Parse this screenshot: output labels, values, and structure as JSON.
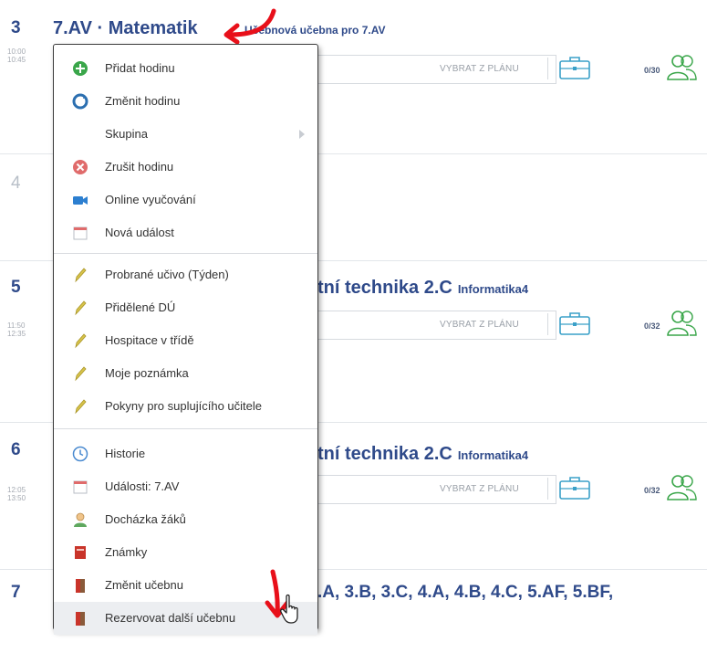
{
  "rows": [
    {
      "num": "3",
      "time_start": "10:00",
      "time_end": "10:45",
      "title": "7.AV · Matematik",
      "room": "Učebnová učebna pro 7.AV"
    },
    {
      "num": "4"
    },
    {
      "num": "5",
      "time_start": "11:50",
      "time_end": "12:35",
      "title": "tní technika  2.C",
      "room": "Informatika4"
    },
    {
      "num": "6",
      "time_start": "12:05",
      "time_end": "13:50",
      "title": "tní technika  2.C",
      "room": "Informatika4"
    },
    {
      "num": "7",
      "title": ".A, 3.B, 3.C, 4.A, 4.B, 4.C, 5.AF, 5.BF,"
    }
  ],
  "plan_button_label": "VYBRAT Z PLÁNU",
  "counts": [
    "0/30",
    "0/32",
    "0/32"
  ],
  "menu": {
    "items": [
      {
        "label": "Přidat hodinu",
        "icon": "add-circle-icon"
      },
      {
        "label": "Změnit hodinu",
        "icon": "change-circle-icon"
      },
      {
        "label": "Skupina",
        "icon": "none",
        "submenu": true
      },
      {
        "label": "Zrušit hodinu",
        "icon": "cancel-circle-icon"
      },
      {
        "label": "Online vyučování",
        "icon": "video-camera-icon"
      },
      {
        "label": "Nová událost",
        "icon": "calendar-icon"
      },
      {
        "label": "Probrané učivo (Týden)",
        "icon": "pencil-icon"
      },
      {
        "label": "Přidělené DÚ",
        "icon": "pencil-icon"
      },
      {
        "label": "Hospitace v třídě",
        "icon": "pencil-icon"
      },
      {
        "label": "Moje poznámka",
        "icon": "pencil-icon"
      },
      {
        "label": "Pokyny pro suplujícího učitele",
        "icon": "pencil-icon"
      },
      {
        "label": "Historie",
        "icon": "clock-icon"
      },
      {
        "label": "Události: 7.AV",
        "icon": "calendar-icon"
      },
      {
        "label": "Docházka žáků",
        "icon": "student-icon"
      },
      {
        "label": "Známky",
        "icon": "grades-book-icon"
      },
      {
        "label": "Změnit učebnu",
        "icon": "door-icon"
      },
      {
        "label": "Rezervovat další učebnu",
        "icon": "door-icon"
      }
    ]
  },
  "colors": {
    "accent": "#2f4a8a",
    "annotation": "#e8101a",
    "green": "#3aa64a"
  }
}
